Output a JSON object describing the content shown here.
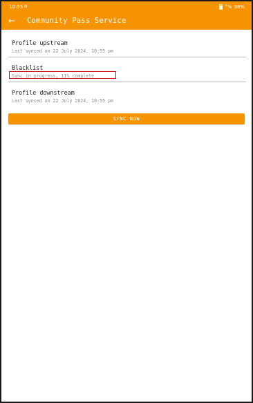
{
  "status_bar": {
    "time": "10:55",
    "icon": "gear-icon",
    "signal_text": "°%",
    "battery_text": "98%"
  },
  "app_bar": {
    "back_icon": "arrow-left-icon",
    "title": "Community Pass Service"
  },
  "sync_items": [
    {
      "title": "Profile upstream",
      "status": "Last synced on 22 July 2024, 10:55 pm"
    },
    {
      "title": "Blacklist",
      "status": "Sync in progress, 11% complete",
      "progress_percent": 11,
      "highlighted": true
    },
    {
      "title": "Profile downstream",
      "status": "Last synced on 22 July 2024, 10:55 pm"
    }
  ],
  "sync_button": {
    "label": "SYNC NOW"
  },
  "colors": {
    "accent": "#f59300",
    "highlight_border": "#cc1111",
    "divider": "#b5b5b5",
    "secondary_text": "#8a8a8a"
  }
}
